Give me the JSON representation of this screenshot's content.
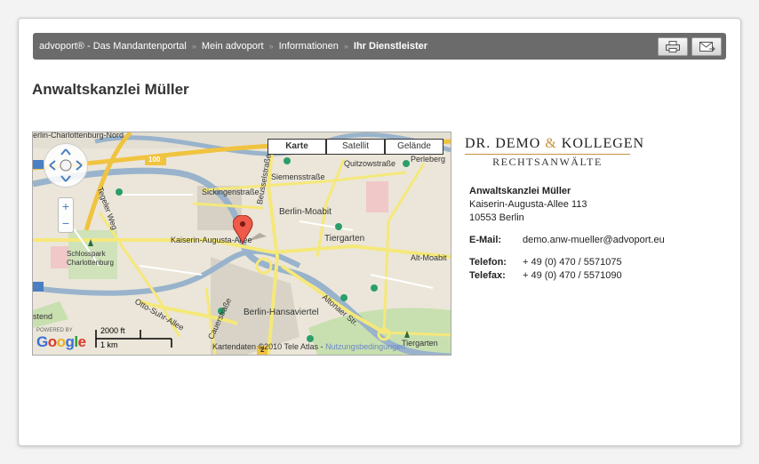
{
  "breadcrumb": {
    "items": [
      "advoport® - Das Mandantenportal",
      "Mein advoport",
      "Informationen"
    ],
    "current": "Ihr Dienstleister"
  },
  "toolbar": {
    "print_icon": "printer-icon",
    "mail_icon": "mail-icon"
  },
  "page": {
    "title": "Anwaltskanzlei Müller"
  },
  "map": {
    "types": [
      "Karte",
      "Satellit",
      "Gelände"
    ],
    "selected_type": "Karte",
    "labels": {
      "charlottenburg_nord": "erlin-Charlottenburg-Nord",
      "siemensstrasse": "Siemensstraße",
      "quitzowstrasse": "Quitzowstraße",
      "perleberg": "Perleberg",
      "sickingen": "Sickingenstraße",
      "beusselstrasse": "Beusselstraße",
      "moabit": "Berlin-Moabit",
      "tegeler_weg": "Tegeler Weg",
      "kaiserin": "Kaiserin-Augusta-Allee",
      "tiergarten": "Tiergarten",
      "alt_moabit": "Alt-Moabit",
      "schlosspark": "Schlosspark Charlottenburg",
      "otto_suhr": "Otto-Suhr-Allee",
      "hansaviertel": "Berlin-Hansaviertel",
      "altonaer": "Altonaer Str.",
      "cauerstrasse": "Cauerstraße",
      "tiergarten2": "Tiergarten",
      "stend": "stend",
      "highway_100": "100",
      "route_2": "2"
    },
    "zoom_in": "+",
    "zoom_out": "−",
    "powered_by": "POWERED BY",
    "google": "Google",
    "scale_ft": "2000 ft",
    "scale_km": "1 km",
    "copyright": "Kartendaten ©2010 Tele Atlas - ",
    "terms_link": "Nutzungsbedingungen",
    "marker_icon": "map-marker-icon"
  },
  "logo": {
    "line1a": "DR. DEMO ",
    "amp": "&",
    "line1b": " KOLLEGEN",
    "line2": "RECHTSANWÄLTE"
  },
  "contact": {
    "name": "Anwaltskanzlei Müller",
    "street": "Kaiserin-Augusta-Allee 113",
    "city": "10553 Berlin",
    "email_label": "E-Mail:",
    "email": "demo.anw-mueller@advoport.eu",
    "phone_label": "Telefon:",
    "phone": "+ 49 (0) 470 / 5571075",
    "fax_label": "Telefax:",
    "fax": "+ 49 (0) 470 / 5571090"
  }
}
